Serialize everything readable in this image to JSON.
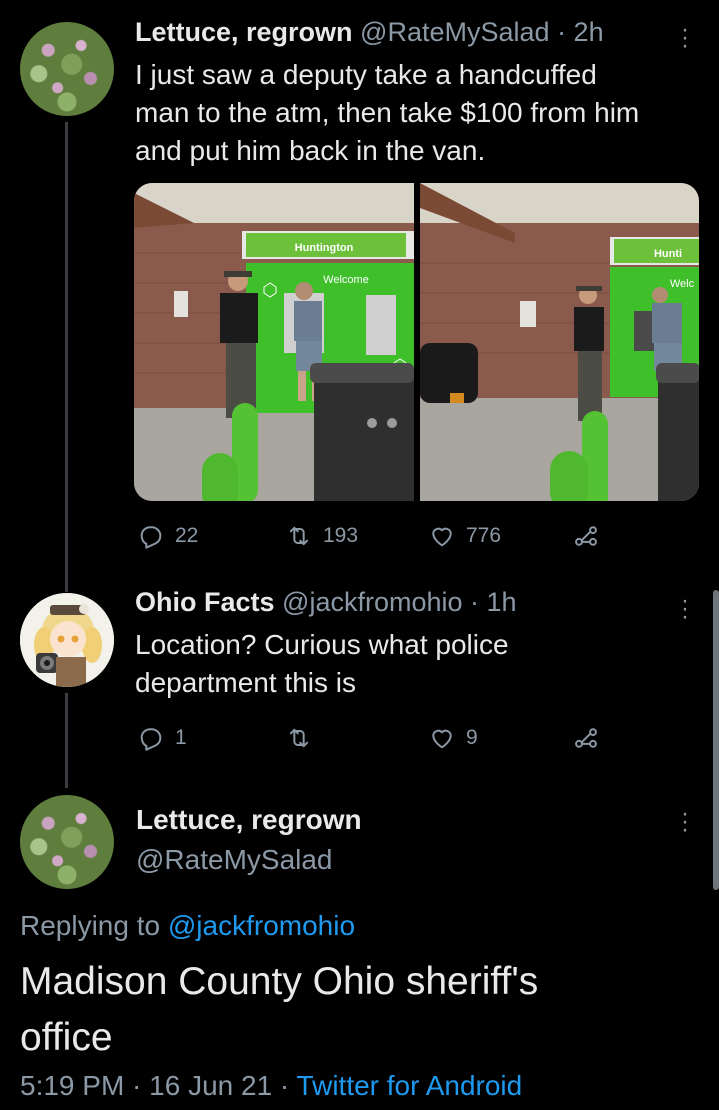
{
  "tweet1": {
    "display_name": "Lettuce, regrown",
    "handle": "@RateMySalad",
    "time": "· 2h",
    "text_lines": [
      "I just saw a deputy take a handcuffed",
      "man to the atm, then take $100 from him",
      "and put him back in the van."
    ],
    "media": {
      "sign_left": "Huntington",
      "welcome_left": "Welcome",
      "sign_right": "Hunti",
      "welcome_right": "Welc"
    },
    "replies": "22",
    "retweets": "193",
    "likes": "776"
  },
  "tweet2": {
    "display_name": "Ohio Facts",
    "handle": "@jackfromohio",
    "time": "· 1h",
    "text_lines": [
      "Location? Curious what police",
      "department this is"
    ],
    "replies": "1",
    "retweets": "",
    "likes": "9"
  },
  "tweet3": {
    "display_name": "Lettuce, regrown",
    "handle": "@RateMySalad",
    "replying_prefix": "Replying to",
    "replying_to": "@jackfromohio",
    "text_lines": [
      "Madison County Ohio sheriff's",
      "office"
    ],
    "timestamp": "5:19 PM · 16 Jun 21 ·",
    "client": "Twitter for Android"
  },
  "colors": {
    "background": "#000000",
    "text": "#e7e9ea",
    "muted": "#8b98a5",
    "link": "#1d9bf0",
    "thread_line": "#3a3e42"
  },
  "icons": [
    "reply-icon",
    "retweet-icon",
    "like-icon",
    "share-icon",
    "more-icon"
  ]
}
